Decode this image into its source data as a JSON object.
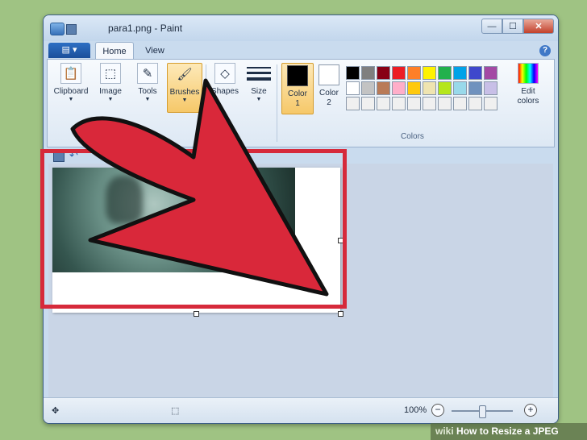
{
  "window": {
    "title": "para1.png - Paint",
    "minimize_label": "—",
    "maximize_label": "☐",
    "close_label": "✕"
  },
  "tabs": {
    "paint_menu_label": "▤ ▾",
    "home": "Home",
    "view": "View",
    "help_label": "?"
  },
  "ribbon": {
    "clipboard": "Clipboard",
    "image": "Image",
    "tools": "Tools",
    "brushes": "Brushes",
    "shapes": "Shapes",
    "size": "Size",
    "color1": "Color\n1",
    "color2": "Color\n2",
    "edit_colors": "Edit\ncolors",
    "colors_group": "Colors"
  },
  "palette": [
    "#000000",
    "#7f7f7f",
    "#880015",
    "#ed1c24",
    "#ff7f27",
    "#fff200",
    "#22b14c",
    "#00a2e8",
    "#3f48cc",
    "#a349a4",
    "#ffffff",
    "#c3c3c3",
    "#b97a57",
    "#ffaec9",
    "#ffc90e",
    "#efe4b0",
    "#b5e61d",
    "#99d9ea",
    "#7092be",
    "#c8bfe7",
    "#f0f0f0",
    "#f0f0f0",
    "#f0f0f0",
    "#f0f0f0",
    "#f0f0f0",
    "#f0f0f0",
    "#f0f0f0",
    "#f0f0f0",
    "#f0f0f0",
    "#f0f0f0"
  ],
  "colors": {
    "color1_value": "#000000",
    "color2_value": "#ffffff",
    "highlight": "#d62a3b",
    "arrow_fill": "#d9283a"
  },
  "statusbar": {
    "zoom": "100%",
    "zoom_out": "−",
    "zoom_in": "+"
  },
  "watermark": {
    "logo": "wiki",
    "title": "How to Resize a JPEG"
  }
}
